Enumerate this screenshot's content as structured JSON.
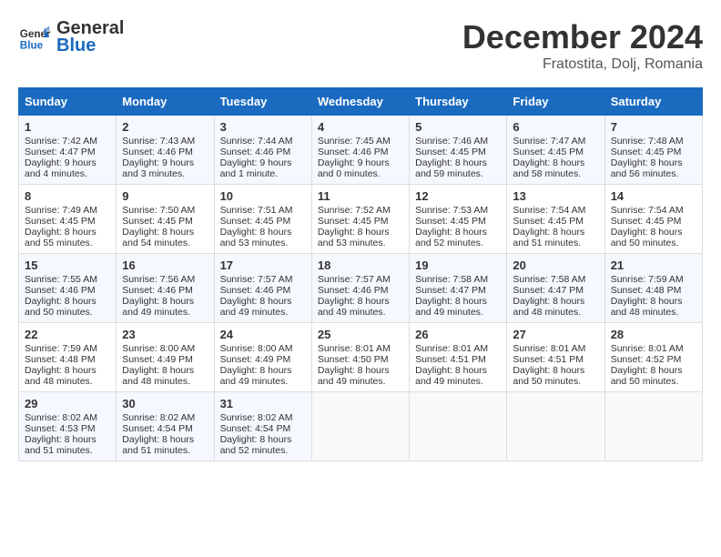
{
  "header": {
    "logo_general": "General",
    "logo_blue": "Blue",
    "month": "December 2024",
    "location": "Fratostita, Dolj, Romania"
  },
  "days_of_week": [
    "Sunday",
    "Monday",
    "Tuesday",
    "Wednesday",
    "Thursday",
    "Friday",
    "Saturday"
  ],
  "weeks": [
    [
      {
        "day": "1",
        "sunrise": "7:42 AM",
        "sunset": "4:47 PM",
        "daylight": "9 hours and 4 minutes."
      },
      {
        "day": "2",
        "sunrise": "7:43 AM",
        "sunset": "4:46 PM",
        "daylight": "9 hours and 3 minutes."
      },
      {
        "day": "3",
        "sunrise": "7:44 AM",
        "sunset": "4:46 PM",
        "daylight": "9 hours and 1 minute."
      },
      {
        "day": "4",
        "sunrise": "7:45 AM",
        "sunset": "4:46 PM",
        "daylight": "9 hours and 0 minutes."
      },
      {
        "day": "5",
        "sunrise": "7:46 AM",
        "sunset": "4:45 PM",
        "daylight": "8 hours and 59 minutes."
      },
      {
        "day": "6",
        "sunrise": "7:47 AM",
        "sunset": "4:45 PM",
        "daylight": "8 hours and 58 minutes."
      },
      {
        "day": "7",
        "sunrise": "7:48 AM",
        "sunset": "4:45 PM",
        "daylight": "8 hours and 56 minutes."
      }
    ],
    [
      {
        "day": "8",
        "sunrise": "7:49 AM",
        "sunset": "4:45 PM",
        "daylight": "8 hours and 55 minutes."
      },
      {
        "day": "9",
        "sunrise": "7:50 AM",
        "sunset": "4:45 PM",
        "daylight": "8 hours and 54 minutes."
      },
      {
        "day": "10",
        "sunrise": "7:51 AM",
        "sunset": "4:45 PM",
        "daylight": "8 hours and 53 minutes."
      },
      {
        "day": "11",
        "sunrise": "7:52 AM",
        "sunset": "4:45 PM",
        "daylight": "8 hours and 53 minutes."
      },
      {
        "day": "12",
        "sunrise": "7:53 AM",
        "sunset": "4:45 PM",
        "daylight": "8 hours and 52 minutes."
      },
      {
        "day": "13",
        "sunrise": "7:54 AM",
        "sunset": "4:45 PM",
        "daylight": "8 hours and 51 minutes."
      },
      {
        "day": "14",
        "sunrise": "7:54 AM",
        "sunset": "4:45 PM",
        "daylight": "8 hours and 50 minutes."
      }
    ],
    [
      {
        "day": "15",
        "sunrise": "7:55 AM",
        "sunset": "4:46 PM",
        "daylight": "8 hours and 50 minutes."
      },
      {
        "day": "16",
        "sunrise": "7:56 AM",
        "sunset": "4:46 PM",
        "daylight": "8 hours and 49 minutes."
      },
      {
        "day": "17",
        "sunrise": "7:57 AM",
        "sunset": "4:46 PM",
        "daylight": "8 hours and 49 minutes."
      },
      {
        "day": "18",
        "sunrise": "7:57 AM",
        "sunset": "4:46 PM",
        "daylight": "8 hours and 49 minutes."
      },
      {
        "day": "19",
        "sunrise": "7:58 AM",
        "sunset": "4:47 PM",
        "daylight": "8 hours and 49 minutes."
      },
      {
        "day": "20",
        "sunrise": "7:58 AM",
        "sunset": "4:47 PM",
        "daylight": "8 hours and 48 minutes."
      },
      {
        "day": "21",
        "sunrise": "7:59 AM",
        "sunset": "4:48 PM",
        "daylight": "8 hours and 48 minutes."
      }
    ],
    [
      {
        "day": "22",
        "sunrise": "7:59 AM",
        "sunset": "4:48 PM",
        "daylight": "8 hours and 48 minutes."
      },
      {
        "day": "23",
        "sunrise": "8:00 AM",
        "sunset": "4:49 PM",
        "daylight": "8 hours and 48 minutes."
      },
      {
        "day": "24",
        "sunrise": "8:00 AM",
        "sunset": "4:49 PM",
        "daylight": "8 hours and 49 minutes."
      },
      {
        "day": "25",
        "sunrise": "8:01 AM",
        "sunset": "4:50 PM",
        "daylight": "8 hours and 49 minutes."
      },
      {
        "day": "26",
        "sunrise": "8:01 AM",
        "sunset": "4:51 PM",
        "daylight": "8 hours and 49 minutes."
      },
      {
        "day": "27",
        "sunrise": "8:01 AM",
        "sunset": "4:51 PM",
        "daylight": "8 hours and 50 minutes."
      },
      {
        "day": "28",
        "sunrise": "8:01 AM",
        "sunset": "4:52 PM",
        "daylight": "8 hours and 50 minutes."
      }
    ],
    [
      {
        "day": "29",
        "sunrise": "8:02 AM",
        "sunset": "4:53 PM",
        "daylight": "8 hours and 51 minutes."
      },
      {
        "day": "30",
        "sunrise": "8:02 AM",
        "sunset": "4:54 PM",
        "daylight": "8 hours and 51 minutes."
      },
      {
        "day": "31",
        "sunrise": "8:02 AM",
        "sunset": "4:54 PM",
        "daylight": "8 hours and 52 minutes."
      },
      null,
      null,
      null,
      null
    ]
  ]
}
